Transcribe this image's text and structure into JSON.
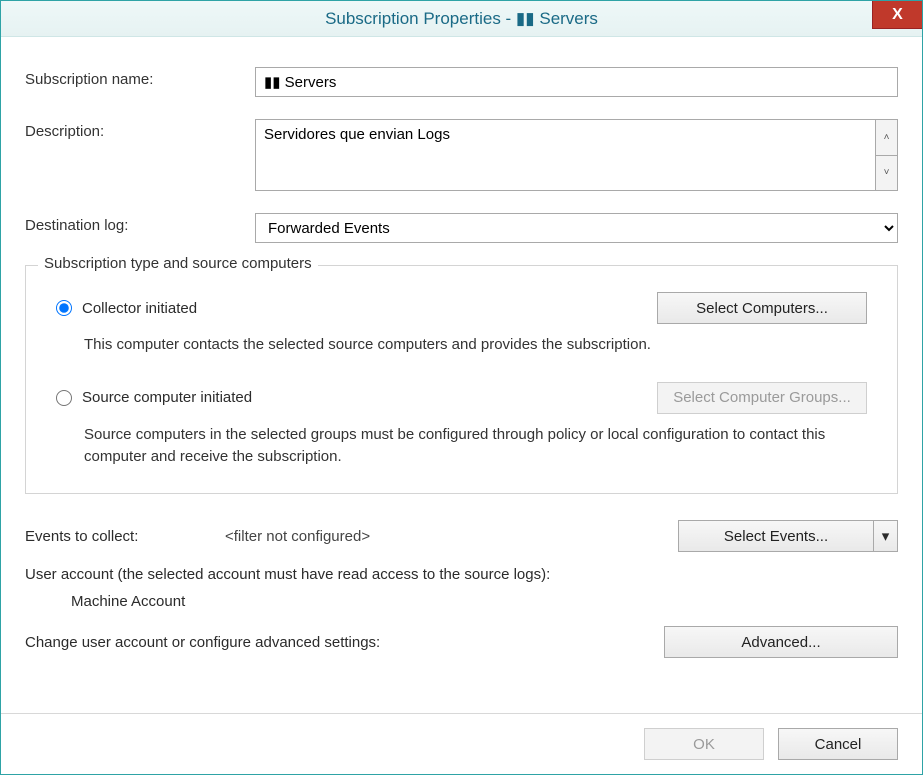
{
  "title": "Subscription Properties - ▮▮ Servers",
  "labels": {
    "subscription_name": "Subscription name:",
    "description": "Description:",
    "destination_log": "Destination log:",
    "groupbox": "Subscription type and source computers",
    "collector_initiated": "Collector initiated",
    "collector_help": "This computer contacts the selected source computers and provides the subscription.",
    "source_initiated": "Source computer initiated",
    "source_help": "Source computers in the selected groups must be configured through policy or local configuration to contact this computer and receive the subscription.",
    "events_to_collect": "Events to collect:",
    "filter_value": "<filter not configured>",
    "user_account_line": "User account (the selected account must have read access to the source logs):",
    "machine_account": "Machine Account",
    "advanced_line": "Change user account or configure advanced settings:"
  },
  "buttons": {
    "select_computers": "Select Computers...",
    "select_computer_groups": "Select Computer Groups...",
    "select_events": "Select Events...",
    "advanced": "Advanced...",
    "ok": "OK",
    "cancel": "Cancel",
    "close": "X"
  },
  "fields": {
    "subscription_name": "▮▮ Servers",
    "description": "Servidores que envian Logs",
    "destination_log": "Forwarded Events"
  }
}
